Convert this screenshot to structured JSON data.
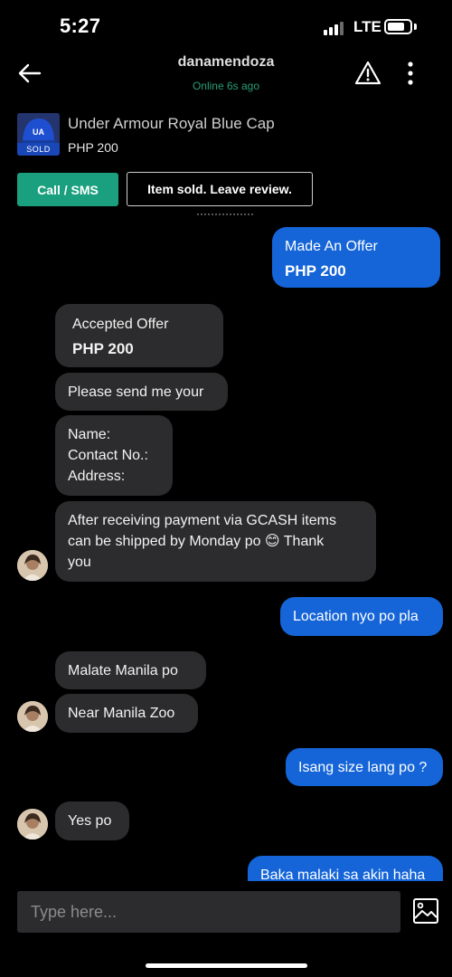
{
  "status_bar": {
    "time": "5:27",
    "network": "LTE",
    "battery_percent": 80
  },
  "header": {
    "username": "danamendoza",
    "presence": "Online 6s ago"
  },
  "listing": {
    "title": "Under Armour Royal Blue Cap",
    "price": "PHP 200",
    "badge": "SOLD"
  },
  "actions": {
    "call_sms": "Call / SMS",
    "leave_review": "Item sold. Leave review."
  },
  "messages": [
    {
      "side": "out",
      "type": "offer",
      "label": "Made An Offer",
      "amount": "PHP 200"
    },
    {
      "side": "in",
      "type": "offer",
      "label": "Accepted Offer",
      "amount": "PHP 200"
    },
    {
      "side": "in",
      "type": "text",
      "lines": [
        "Please send me your"
      ]
    },
    {
      "side": "in",
      "type": "text",
      "lines": [
        "Name:",
        "Contact No.:",
        "Address:"
      ]
    },
    {
      "side": "in",
      "type": "text",
      "lines": [
        "After receiving payment via GCASH items",
        "can be shipped by Monday po 😊 Thank",
        "you"
      ]
    },
    {
      "side": "out",
      "type": "text",
      "lines": [
        "Location nyo po pla"
      ]
    },
    {
      "side": "in",
      "type": "text",
      "lines": [
        "Malate Manila po"
      ]
    },
    {
      "side": "in",
      "type": "text",
      "lines": [
        "Near Manila Zoo"
      ]
    },
    {
      "side": "out",
      "type": "text",
      "lines": [
        "Isang size lang po ?"
      ]
    },
    {
      "side": "in",
      "type": "text",
      "lines": [
        "Yes po"
      ]
    },
    {
      "side": "out",
      "type": "text",
      "lines": [
        "Baka malaki sa akin haha"
      ]
    }
  ],
  "composer": {
    "placeholder": "Type here..."
  },
  "colors": {
    "accent_green": "#1aa07e",
    "outgoing_bubble": "#1565d8",
    "incoming_bubble": "#2c2c2e",
    "presence_green": "#2a9d78"
  },
  "icons": {
    "back": "arrow-left-icon",
    "report": "warning-triangle-icon",
    "more": "more-vertical-icon",
    "image_picker": "image-icon"
  }
}
